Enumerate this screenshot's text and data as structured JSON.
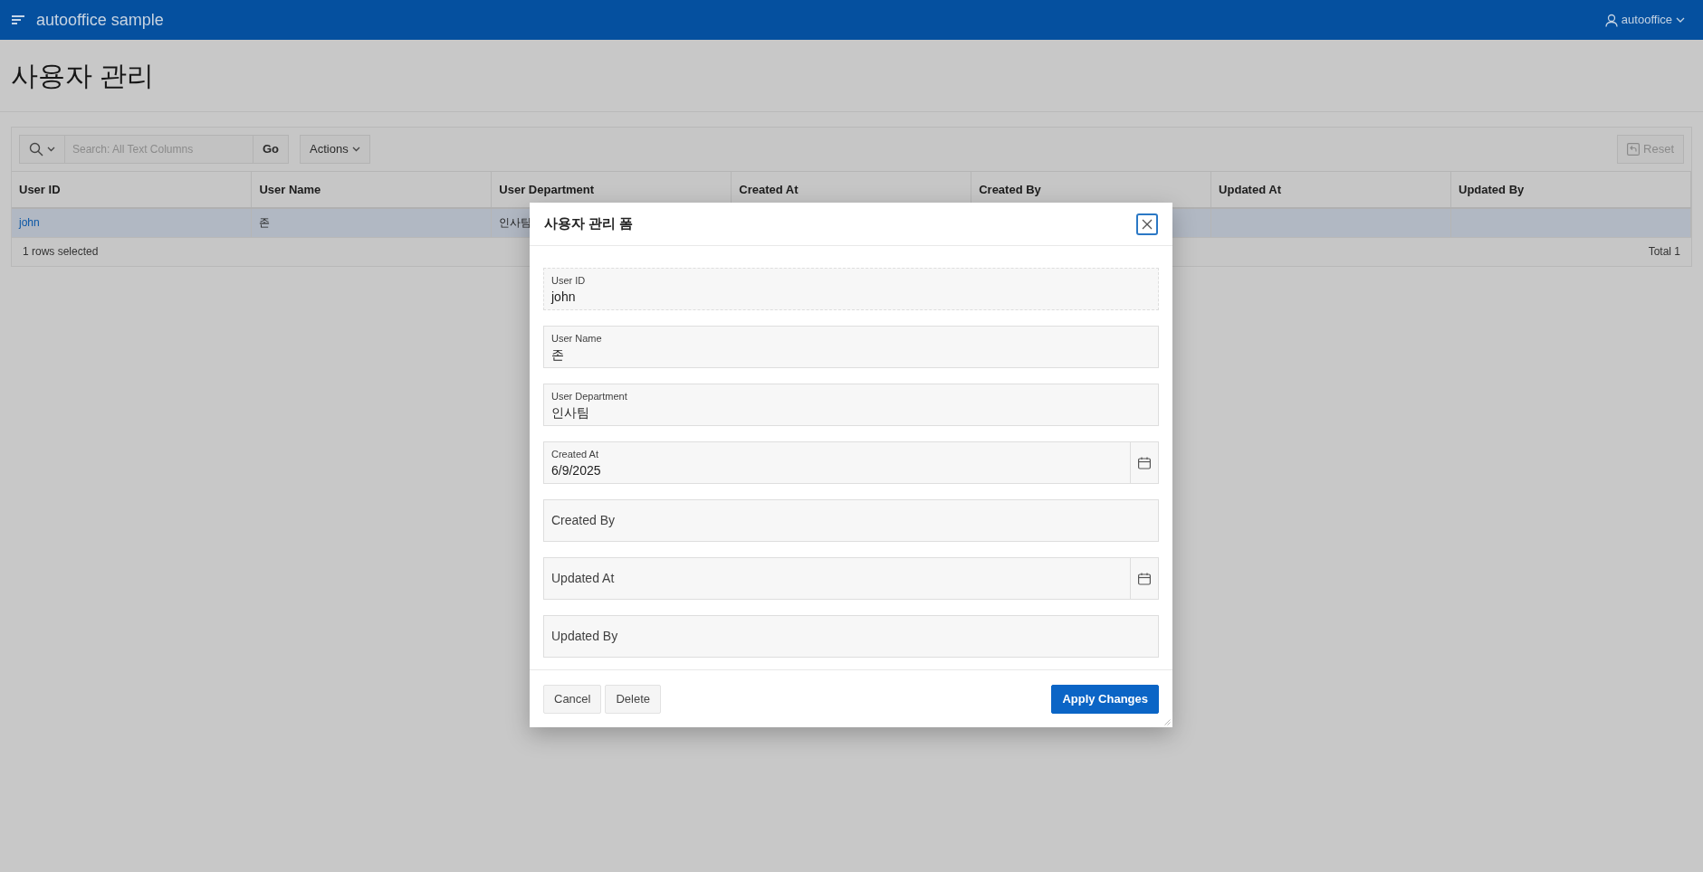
{
  "header": {
    "app_title": "autooffice sample",
    "user": "autooffice"
  },
  "page_title": "사용자 관리",
  "report": {
    "search": {
      "placeholder": "Search: All Text Columns"
    },
    "go_button": "Go",
    "actions_button": "Actions",
    "reset_button": "Reset",
    "columns": [
      "User ID",
      "User Name",
      "User Department",
      "Created At",
      "Created By",
      "Updated At",
      "Updated By"
    ],
    "rows": [
      {
        "selected": true,
        "cells": [
          "john",
          "존",
          "인사팀"
        ]
      }
    ],
    "footer_left": "1 rows selected",
    "footer_right": "Total 1"
  },
  "dialog": {
    "title": "사용자 관리 폼",
    "fields": [
      {
        "kind": "display",
        "label": "User ID",
        "value": "john"
      },
      {
        "kind": "text",
        "label": "User Name",
        "value": "존"
      },
      {
        "kind": "text",
        "label": "User Department",
        "value": "인사팀"
      },
      {
        "kind": "date",
        "label": "Created At",
        "value": "6/9/2025"
      },
      {
        "kind": "text",
        "label": "Created By"
      },
      {
        "kind": "date",
        "label": "Updated At"
      },
      {
        "kind": "text",
        "label": "Updated By"
      }
    ],
    "buttons": [
      {
        "label": "Cancel",
        "kind": "secondary"
      },
      {
        "label": "Delete",
        "kind": "secondary"
      },
      {
        "label": "Apply Changes",
        "kind": "primary"
      }
    ]
  }
}
